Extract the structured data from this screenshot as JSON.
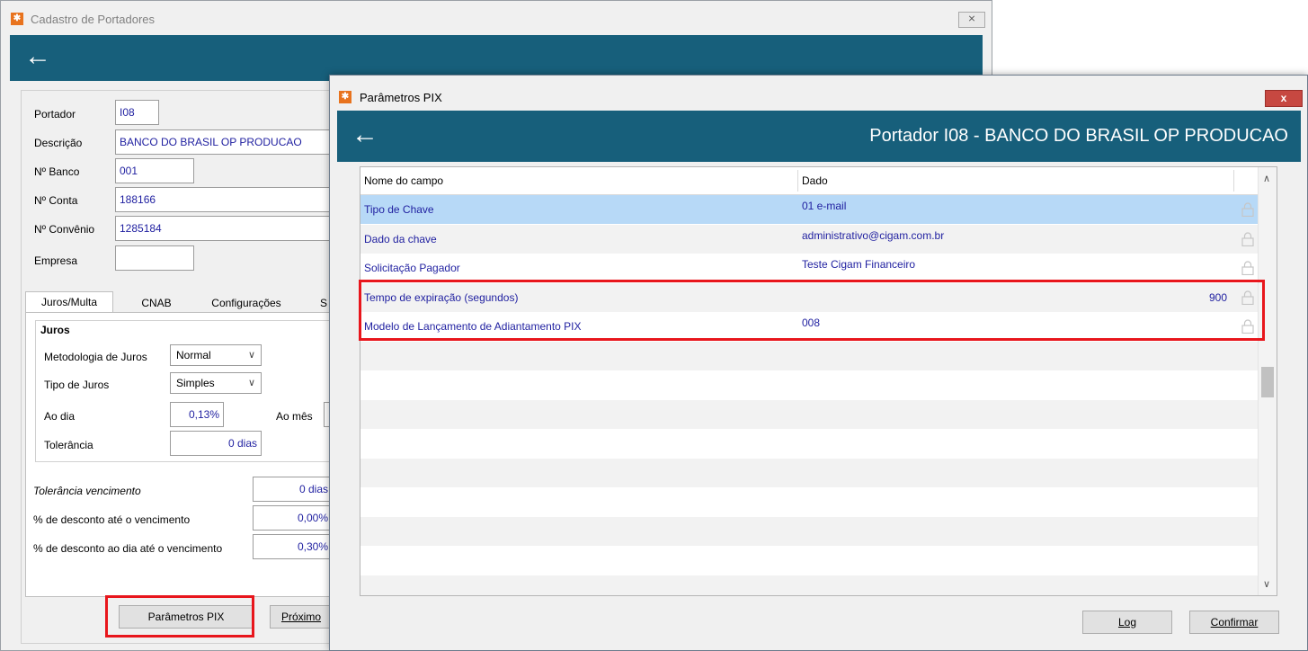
{
  "back_window": {
    "title": "Cadastro de Portadores",
    "close_label": "⨯",
    "fields": [
      {
        "label": "Portador",
        "value": "I08"
      },
      {
        "label": "Descrição",
        "value": "BANCO DO BRASIL OP PRODUCAO"
      },
      {
        "label": "Nº Banco",
        "value": "001"
      },
      {
        "label": "Nº Conta",
        "value": "188166"
      },
      {
        "label": "Nº Convênio",
        "value": "1285184"
      },
      {
        "label": "Empresa",
        "value": ""
      }
    ],
    "tabs": [
      "Juros/Multa",
      "CNAB",
      "Configurações",
      "S"
    ],
    "juros": {
      "group_title": "Juros",
      "metodologia_label": "Metodologia de Juros",
      "metodologia_value": "Normal",
      "tipo_label": "Tipo de Juros",
      "tipo_value": "Simples",
      "ao_dia_label": "Ao dia",
      "ao_dia_value": "0,13%",
      "ao_mes_label": "Ao mês",
      "tolerancia_label": "Tolerância",
      "tolerancia_value": "0 dias"
    },
    "extra": {
      "tol_venc_label": "Tolerância vencimento",
      "tol_venc_value": "0 dias",
      "desc_venc_label": "% de desconto até o vencimento",
      "desc_venc_value": "0,00%",
      "desc_dia_label": "% de desconto ao dia até o vencimento",
      "desc_dia_value": "0,30%"
    },
    "buttons": {
      "pix": "Parâmetros PIX",
      "proximo": "Próximo"
    }
  },
  "front_window": {
    "title": "Parâmetros PIX",
    "close_label": "x",
    "header": "Portador I08 - BANCO DO BRASIL OP PRODUCAO",
    "columns": [
      "Nome do campo",
      "Dado"
    ],
    "rows": [
      {
        "name": "Tipo de Chave",
        "value": "01 e-mail",
        "align": "left",
        "selected": true
      },
      {
        "name": "Dado da chave",
        "value": "administrativo@cigam.com.br",
        "align": "left",
        "selected": false
      },
      {
        "name": "Solicitação Pagador",
        "value": "Teste Cigam Financeiro",
        "align": "left",
        "selected": false
      },
      {
        "name": "Tempo de expiração (segundos)",
        "value": "900",
        "align": "right",
        "selected": false
      },
      {
        "name": "Modelo de Lançamento de Adiantamento PIX",
        "value": "008",
        "align": "left",
        "selected": false
      }
    ],
    "buttons": {
      "log": "Log",
      "confirmar": "Confirmar"
    }
  },
  "colors": {
    "header_blue": "#175f7b",
    "highlight_red": "#e8161c",
    "selected_row": "#b7d9f7",
    "text_blue": "#1f1fa0"
  }
}
